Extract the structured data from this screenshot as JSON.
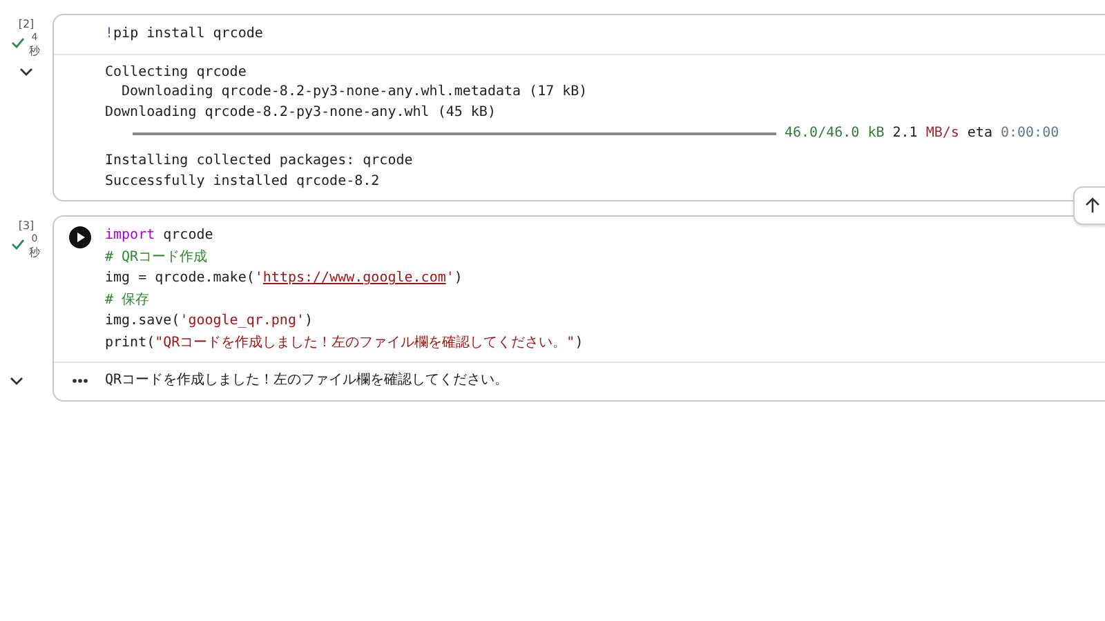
{
  "cells": [
    {
      "exec_count": "[2]",
      "succeeded": true,
      "time": "4",
      "time_unit": "秒",
      "run_button": false,
      "code": [
        [
          {
            "kind": "magic",
            "text": "!"
          },
          {
            "kind": "plain",
            "text": "pip install qrcode"
          }
        ]
      ],
      "output_menu": false,
      "output": [
        {
          "kind": "text",
          "text": "Collecting qrcode"
        },
        {
          "kind": "text",
          "text": "  Downloading qrcode-8.2-py3-none-any.whl.metadata (17 kB)"
        },
        {
          "kind": "text",
          "text": "Downloading qrcode-8.2-py3-none-any.whl (45 kB)"
        },
        {
          "kind": "progress",
          "level": 1,
          "parts": [
            {
              "kind": "size",
              "text": "46.0/46.0 kB"
            },
            {
              "kind": "plain",
              "text": "2.1"
            },
            {
              "kind": "rate",
              "text": "MB/s"
            },
            {
              "kind": "plain",
              "text": "eta"
            },
            {
              "kind": "eta",
              "text": "0:00:00"
            }
          ]
        },
        {
          "kind": "blank"
        },
        {
          "kind": "text",
          "text": "Installing collected packages: qrcode"
        },
        {
          "kind": "text",
          "text": "Successfully installed qrcode-8.2"
        }
      ]
    },
    {
      "exec_count": "[3]",
      "succeeded": true,
      "time": "0",
      "time_unit": "秒",
      "run_button": true,
      "code": [
        [
          {
            "kind": "keyword",
            "text": "import"
          },
          {
            "kind": "plain",
            "text": " qrcode"
          }
        ],
        [
          {
            "kind": "comment",
            "text": "# QRコード作成"
          }
        ],
        [
          {
            "kind": "plain",
            "text": "img = qrcode.make("
          },
          {
            "kind": "string",
            "text": "'"
          },
          {
            "kind": "url",
            "text": "https://www.google.com"
          },
          {
            "kind": "string",
            "text": "'"
          },
          {
            "kind": "plain",
            "text": ")"
          }
        ],
        [
          {
            "kind": "comment",
            "text": "# 保存"
          }
        ],
        [
          {
            "kind": "plain",
            "text": "img.save("
          },
          {
            "kind": "string",
            "text": "'google_qr.png'"
          },
          {
            "kind": "plain",
            "text": ")"
          }
        ],
        [
          {
            "kind": "plain",
            "text": "print("
          },
          {
            "kind": "string",
            "text": "\"QRコードを作成しました！左のファイル欄を確認してください。\""
          },
          {
            "kind": "plain",
            "text": ")"
          }
        ]
      ],
      "output_menu": true,
      "output": [
        {
          "kind": "text",
          "text": "QRコードを作成しました！左のファイル欄を確認してください。"
        }
      ]
    }
  ]
}
